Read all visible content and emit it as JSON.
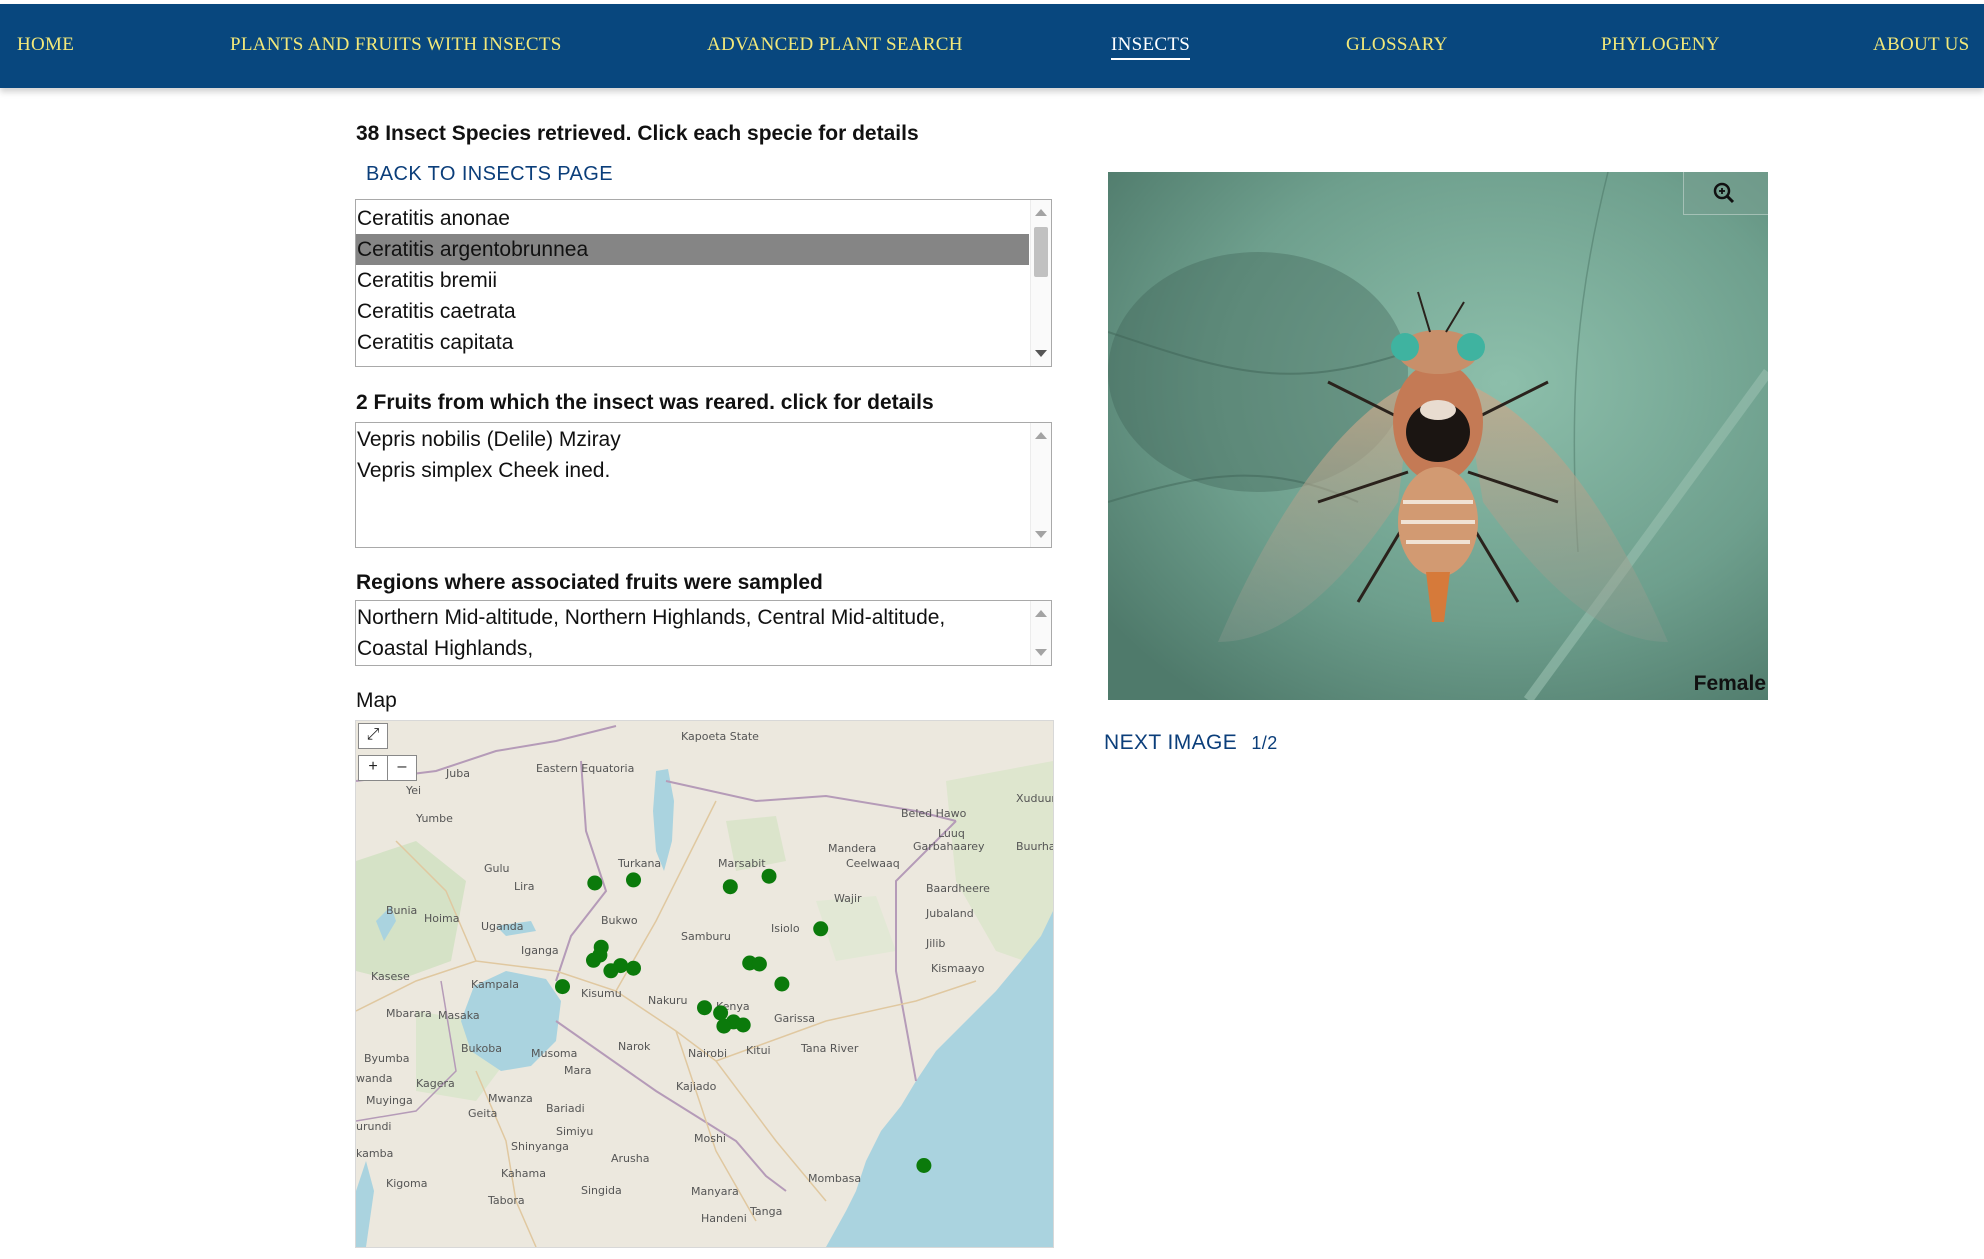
{
  "nav": {
    "items": [
      {
        "label": "HOME"
      },
      {
        "label": "PLANTS AND FRUITS WITH INSECTS"
      },
      {
        "label": "ADVANCED PLANT SEARCH"
      },
      {
        "label": "INSECTS"
      },
      {
        "label": "GLOSSARY"
      },
      {
        "label": "PHYLOGENY"
      },
      {
        "label": "ABOUT US"
      }
    ],
    "active": "INSECTS",
    "background": "#08477e",
    "text_color": "#f2e87a"
  },
  "species": {
    "heading": "38 Insect Species retrieved. Click each specie for details",
    "back_link": "BACK TO INSECTS PAGE",
    "items": [
      "Ceratitis anonae",
      "Ceratitis argentobrunnea",
      "Ceratitis bremii",
      "Ceratitis caetrata",
      "Ceratitis capitata"
    ],
    "selected": "Ceratitis argentobrunnea"
  },
  "fruits": {
    "heading": "2 Fruits from which the insect was reared. click for details",
    "items": [
      "Vepris nobilis (Delile) Mziray",
      "Vepris simplex Cheek ined."
    ]
  },
  "regions": {
    "heading": "Regions where associated fruits were sampled",
    "lines": [
      "Northern Mid-altitude, Northern Highlands, Central Mid-altitude,",
      "Coastal Highlands,"
    ]
  },
  "map": {
    "label": "Map",
    "fullscreen_icon": "expand-icon",
    "zoom_in_label": "+",
    "zoom_out_label": "–",
    "place_labels": [
      "Juba",
      "Eastern Equatoria",
      "Kapoeta State",
      "Yei",
      "Yumbe",
      "Gulu",
      "Lira",
      "Bunia",
      "Hoima",
      "Uganda",
      "Iganga",
      "Kasese",
      "Kampala",
      "Mbarara",
      "Masaka",
      "Bukoba",
      "Musoma",
      "Mara",
      "Byumba",
      "wanda",
      "Kagera",
      "Mwanza",
      "Geita",
      "Bariadi",
      "Simiyu",
      "Shinyanga",
      "Kahama",
      "Tabora",
      "Kigoma",
      "Singida",
      "Arusha",
      "Moshi",
      "Manyara",
      "Handeni",
      "Tanga",
      "Mombasa",
      "Nairobi",
      "Kajiado",
      "Narok",
      "Nakuru",
      "Kenya",
      "Samburu",
      "Turkana",
      "Marsabit",
      "Isiolo",
      "Garissa",
      "Tana River",
      "Kitui",
      "Wajir",
      "Mandera",
      "Ceelwaaq",
      "Garbahaarey",
      "Beled Hawo",
      "Luuq",
      "Xuduur",
      "Baardheere",
      "Jubaland",
      "Jilib",
      "Kismaayo",
      "Buurhakaba",
      "Bukwo",
      "Muyinga",
      "urundi",
      "kamba",
      "Kisumu"
    ],
    "points": [
      {
        "lat": 1.42,
        "lon": 34.5
      },
      {
        "lat": 1.48,
        "lon": 35.1
      },
      {
        "lat": 1.35,
        "lon": 36.6
      },
      {
        "lat": 1.55,
        "lon": 37.2
      },
      {
        "lat": 0.55,
        "lon": 38.0
      },
      {
        "lat": 0.2,
        "lon": 34.6
      },
      {
        "lat": 0.05,
        "lon": 34.58
      },
      {
        "lat": -0.05,
        "lon": 34.48
      },
      {
        "lat": -0.15,
        "lon": 34.9
      },
      {
        "lat": -0.25,
        "lon": 34.75
      },
      {
        "lat": -0.2,
        "lon": 35.1
      },
      {
        "lat": -0.1,
        "lon": 36.9
      },
      {
        "lat": -0.12,
        "lon": 37.05
      },
      {
        "lat": -0.5,
        "lon": 37.4
      },
      {
        "lat": -0.55,
        "lon": 34.0
      },
      {
        "lat": -0.95,
        "lon": 36.2
      },
      {
        "lat": -1.05,
        "lon": 36.45
      },
      {
        "lat": -1.22,
        "lon": 36.65
      },
      {
        "lat": -1.3,
        "lon": 36.5
      },
      {
        "lat": -1.28,
        "lon": 36.8
      },
      {
        "lat": -3.95,
        "lon": 39.6
      }
    ],
    "point_color": "#0b7a0b"
  },
  "image": {
    "caption": "Female",
    "next_label": "NEXT IMAGE",
    "counter": "1/2",
    "zoom_icon": "zoom-in-icon"
  }
}
